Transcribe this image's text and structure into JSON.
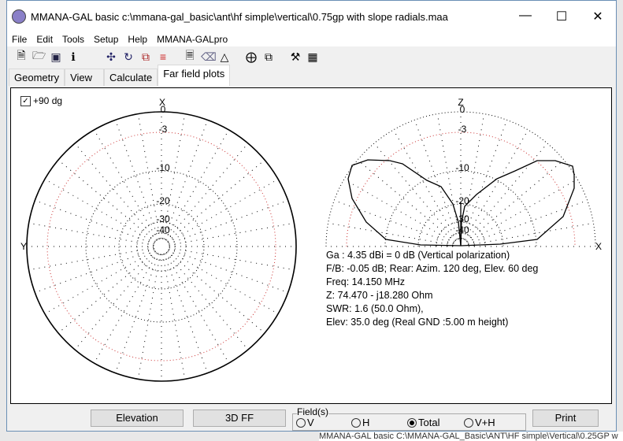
{
  "window": {
    "title": "MMANA-GAL basic c:\\mmana-gal_basic\\ant\\hf simple\\vertical\\0.75gp with slope radials.maa"
  },
  "menu": [
    "File",
    "Edit",
    "Tools",
    "Setup",
    "Help",
    "MMANA-GALpro"
  ],
  "toolbar": [
    "new-file",
    "open-folder",
    "save",
    "info",
    "move",
    "rotate",
    "scale",
    "wires-list",
    "document",
    "eraser",
    "triangle",
    "target",
    "copy",
    "tools",
    "calculator"
  ],
  "tabs": [
    {
      "label": "Geometry"
    },
    {
      "label": "View"
    },
    {
      "label": "Calculate"
    },
    {
      "label": "Far field plots",
      "active": true
    }
  ],
  "horizontal_plot": {
    "checkbox_label": "+90 dg",
    "checked": true,
    "axis_top": "X",
    "axis_left": "Y",
    "ring_labels": [
      "0",
      "-3",
      "-10",
      "-20",
      "-30",
      "-40"
    ]
  },
  "vertical_plot": {
    "axis_top": "Z",
    "axis_right": "X",
    "ring_labels": [
      "0",
      "-3",
      "-10",
      "-20",
      "-30",
      "-40"
    ]
  },
  "info": [
    "Ga : 4.35 dBi = 0 dB  (Vertical polarization)",
    "F/B: -0.05 dB; Rear: Azim. 120 deg,  Elev. 60 deg",
    "Freq: 14.150 MHz",
    "Z: 74.470 - j18.280 Ohm",
    "SWR: 1.6 (50.0 Ohm),",
    "Elev: 35.0 deg (Real GND  :5.00 m height)"
  ],
  "buttons": {
    "elevation": "Elevation",
    "ff3d": "3D FF",
    "print": "Print"
  },
  "fields": {
    "label": "Field(s)",
    "options": [
      "V",
      "H",
      "Total",
      "V+H"
    ],
    "selected": "Total"
  },
  "background_window_title": "MMANA-GAL basic C:\\MMANA-GAL_Basic\\ANT\\HF simple\\Vertical\\0.25GP w"
}
